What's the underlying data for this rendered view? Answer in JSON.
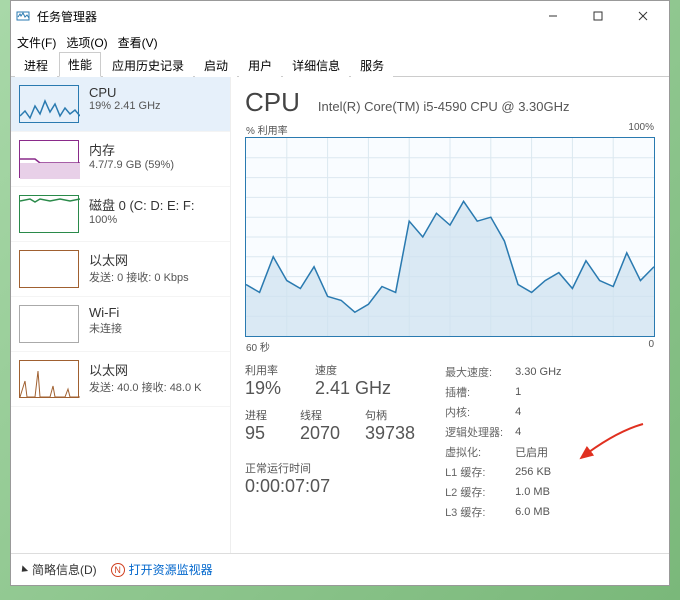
{
  "window": {
    "title": "任务管理器"
  },
  "menu": {
    "file": "文件(F)",
    "options": "选项(O)",
    "view": "查看(V)"
  },
  "tabs": [
    "进程",
    "性能",
    "应用历史记录",
    "启动",
    "用户",
    "详细信息",
    "服务"
  ],
  "active_tab": 1,
  "sidebar": [
    {
      "title": "CPU",
      "sub": "19% 2.41 GHz"
    },
    {
      "title": "内存",
      "sub": "4.7/7.9 GB (59%)"
    },
    {
      "title": "磁盘 0 (C: D: E: F:",
      "sub": "100%"
    },
    {
      "title": "以太网",
      "sub": "发送: 0 接收: 0 Kbps"
    },
    {
      "title": "Wi-Fi",
      "sub": "未连接"
    },
    {
      "title": "以太网",
      "sub": "发送: 40.0 接收: 48.0 K"
    }
  ],
  "main": {
    "title": "CPU",
    "subtitle": "Intel(R) Core(TM) i5-4590 CPU @ 3.30GHz",
    "chart_top_left": "% 利用率",
    "chart_top_right": "100%",
    "chart_bottom_left": "60 秒",
    "chart_bottom_right": "0"
  },
  "stats_left": {
    "labels1": [
      "利用率",
      "速度"
    ],
    "values1": [
      "19%",
      "2.41 GHz"
    ],
    "labels2": [
      "进程",
      "线程",
      "句柄"
    ],
    "values2": [
      "95",
      "2070",
      "39738"
    ],
    "uptime_label": "正常运行时间",
    "uptime_value": "0:00:07:07"
  },
  "stats_right": [
    [
      "最大速度:",
      "3.30 GHz"
    ],
    [
      "插槽:",
      "1"
    ],
    [
      "内核:",
      "4"
    ],
    [
      "逻辑处理器:",
      "4"
    ],
    [
      "虚拟化:",
      "已启用"
    ],
    [
      "L1 缓存:",
      "256 KB"
    ],
    [
      "L2 缓存:",
      "1.0 MB"
    ],
    [
      "L3 缓存:",
      "6.0 MB"
    ]
  ],
  "footer": {
    "brief": "简略信息(D)",
    "resmon": "打开资源监视器"
  },
  "chart_data": {
    "type": "line",
    "title": "% 利用率",
    "ylabel": "%",
    "ylim": [
      0,
      100
    ],
    "xlabel": "秒",
    "xlim": [
      60,
      0
    ],
    "x_seconds_ago": [
      60,
      58,
      56,
      54,
      52,
      50,
      48,
      46,
      44,
      42,
      40,
      38,
      36,
      34,
      32,
      30,
      28,
      26,
      24,
      22,
      20,
      18,
      16,
      14,
      12,
      10,
      8,
      6,
      4,
      2,
      0
    ],
    "values": [
      26,
      22,
      40,
      28,
      24,
      35,
      20,
      18,
      12,
      16,
      25,
      22,
      58,
      50,
      62,
      56,
      68,
      58,
      60,
      48,
      26,
      22,
      28,
      32,
      24,
      38,
      28,
      25,
      42,
      28,
      35
    ]
  }
}
